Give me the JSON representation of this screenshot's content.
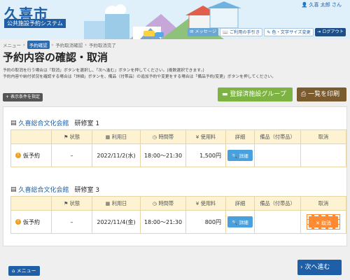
{
  "header": {
    "logo_title": "久喜市",
    "logo_sub": "公共施設予約システム",
    "user_name": "久喜 太郎 さん",
    "buttons": {
      "message": "メッセージ",
      "guide": "ご利用の手引き",
      "color": "色・文字サイズ変更",
      "logout": "ログアウト"
    }
  },
  "breadcrumb": {
    "menu": "メニュー",
    "current": "予約確認",
    "step2": "予約取消確認",
    "step3": "予約取消完了"
  },
  "page_title": "予約内容の確認・取消",
  "description": {
    "line1": "予約の取消を行う場合は「取消」ボタンを選択し、「次へ進む」ボタンを押してください。(複数選択できます。)",
    "line2": "予約内容や納付状況を確認する場合は「詳細」ボタンを、備品（付帯品）の追加予約や変更をする場合は「備品予約/変更」ボタンを押してください。"
  },
  "toolbar": {
    "filter_label": "表示条件を指定",
    "group_label": "登録済施設グループ",
    "print_label": "一覧を印刷"
  },
  "table_headers": {
    "status": "状態",
    "date": "利用日",
    "time": "時間帯",
    "fee": "使用料",
    "detail": "詳細",
    "equipment": "備品（付帯品）",
    "cancel": "取消"
  },
  "reservations": [
    {
      "facility": "久喜総合文化会館",
      "room": "研修室 1",
      "status": "仮予約",
      "status_flag": "–",
      "date": "2022/11/2(水)",
      "time": "18:00～21:30",
      "fee": "1,500円",
      "detail_label": "詳細",
      "cancel_label": ""
    },
    {
      "facility": "久喜総合文化会館",
      "room": "研修室 3",
      "status": "仮予約",
      "status_flag": "–",
      "date": "2022/11/4(金)",
      "time": "18:00～21:30",
      "fee": "800円",
      "detail_label": "詳細",
      "cancel_label": "取消"
    }
  ],
  "footer": {
    "menu_label": "メニュー",
    "next_label": "次へ進む"
  },
  "colors": {
    "primary": "#1f5fa8",
    "group_button": "#7cb342",
    "print_button": "#7b5a2e",
    "cancel_button": "#ff8a34",
    "table_header": "#fdf3d2"
  }
}
